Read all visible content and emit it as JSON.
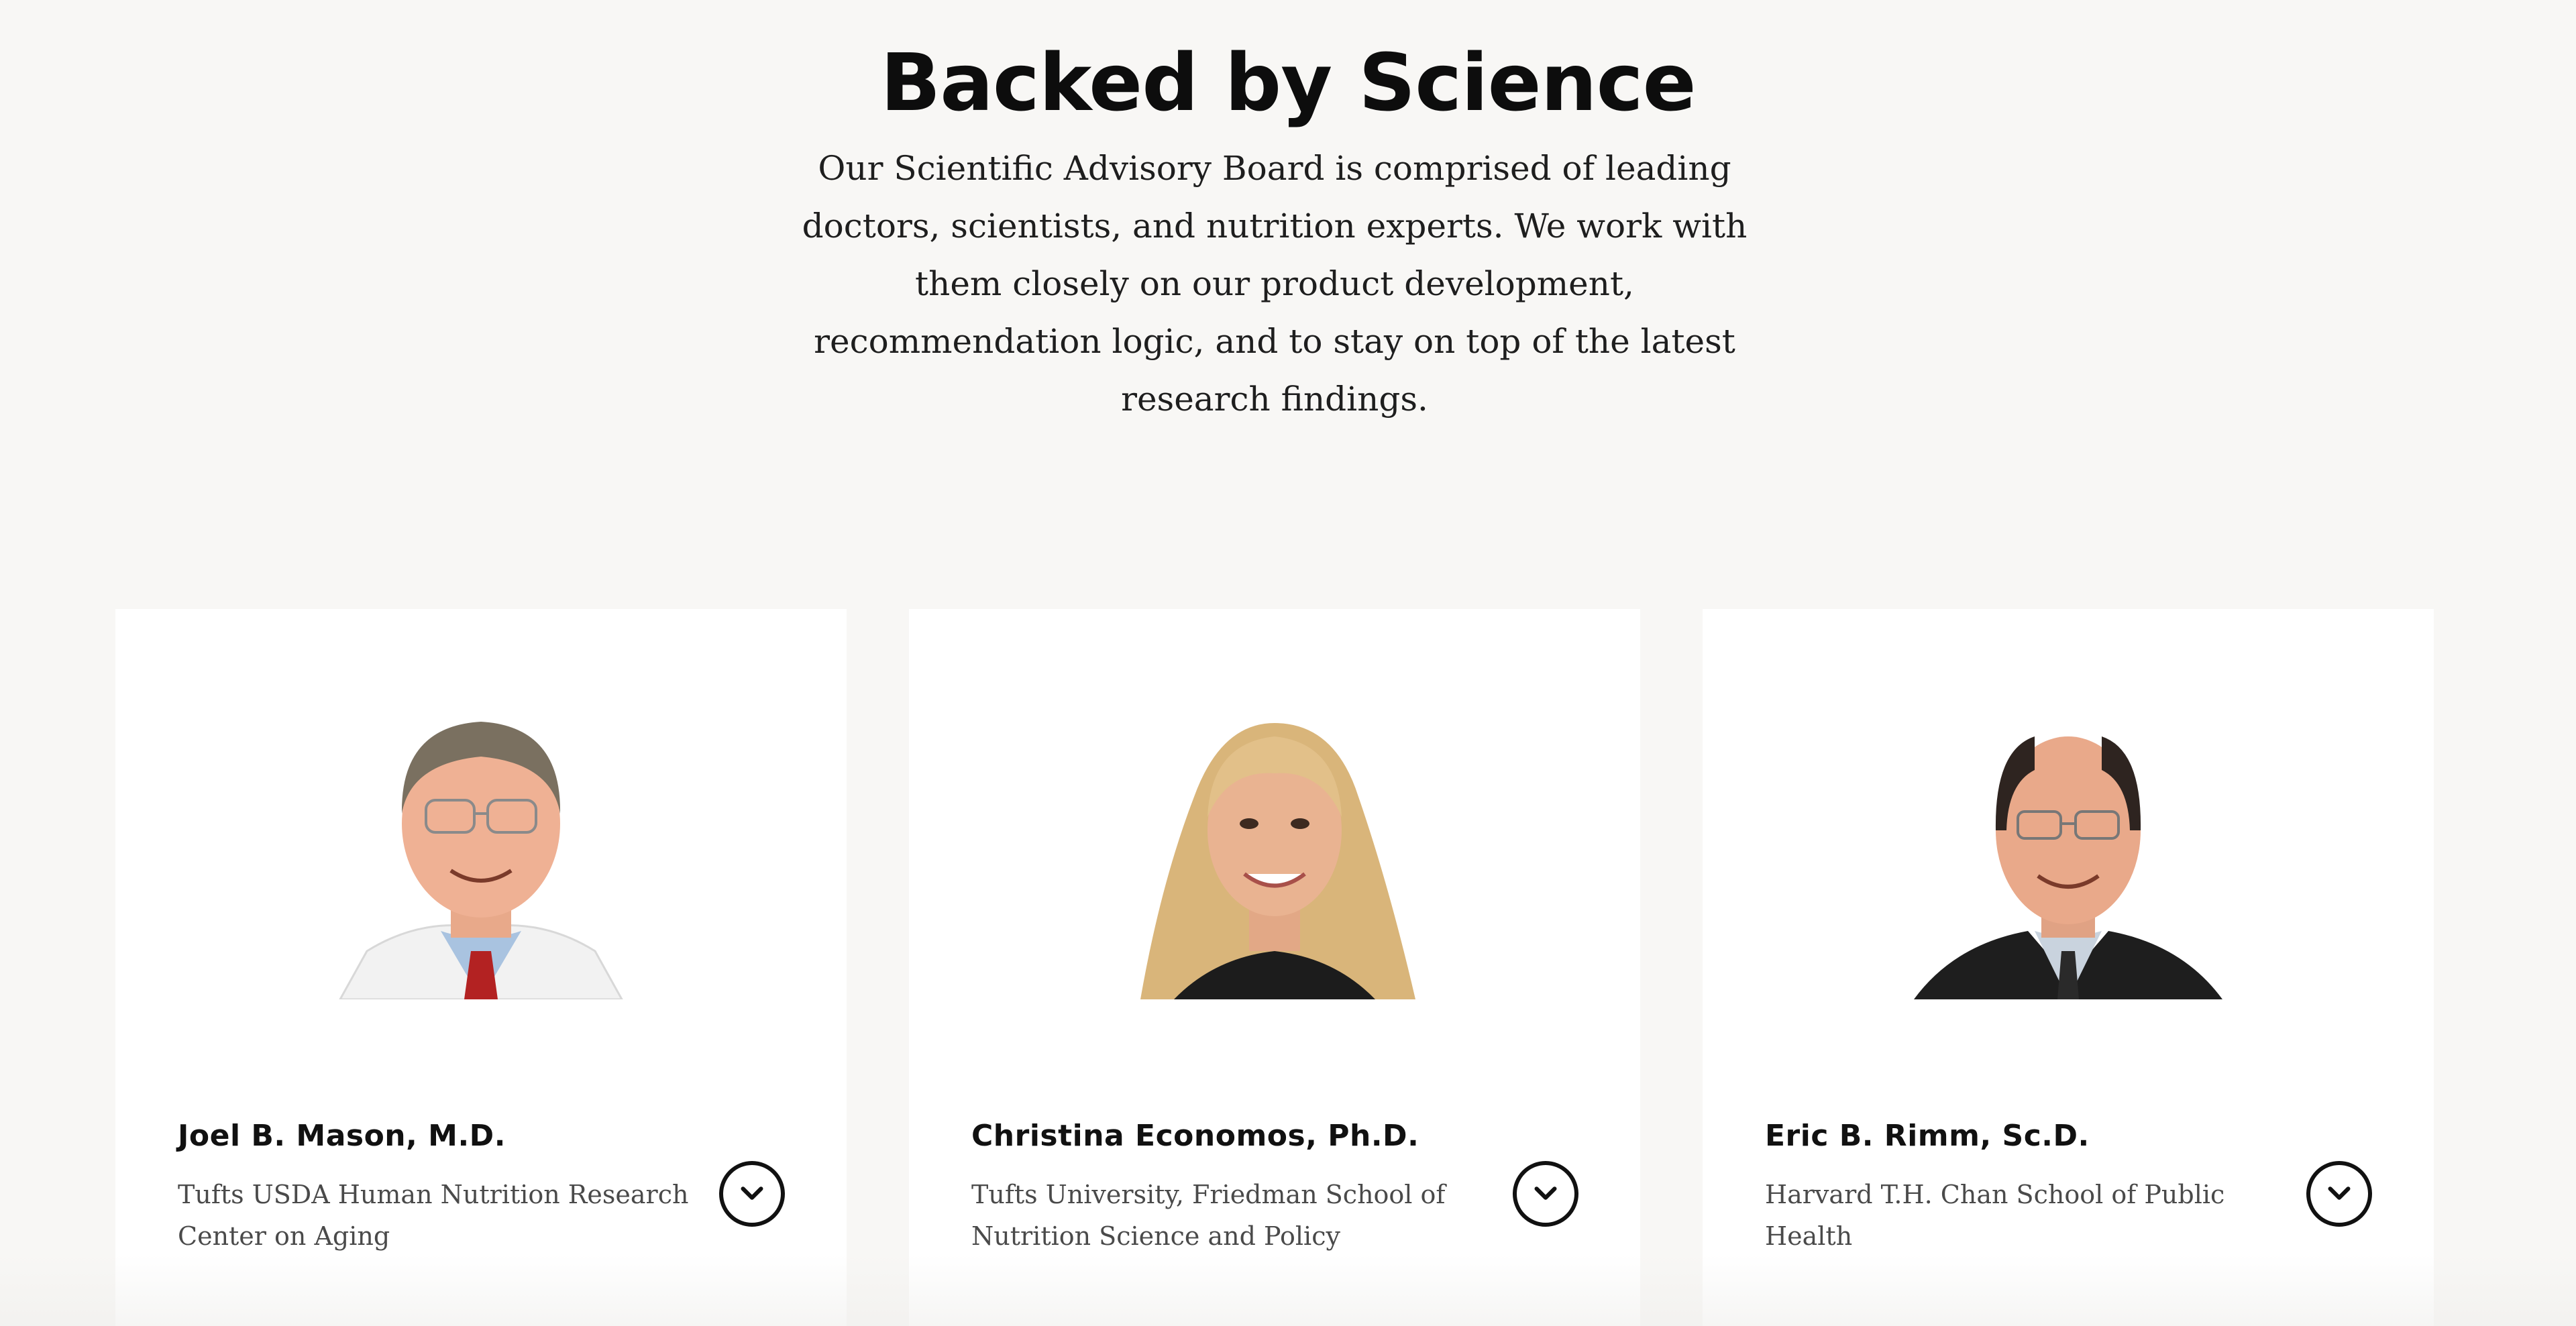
{
  "section": {
    "title": "Backed by Science",
    "intro": "Our Scientific Advisory Board is comprised of leading doctors, scientists, and nutrition experts. We work with them closely on our product development, recommendation logic, and to stay on top of the latest research findings."
  },
  "advisors": [
    {
      "name": "Joel B. Mason, M.D.",
      "affiliation": "Tufts USDA Human Nutrition Research Center on Aging",
      "icon": "chevron-down-icon"
    },
    {
      "name": "Christina Economos, Ph.D.",
      "affiliation": "Tufts University, Friedman School of Nutrition Science and Policy",
      "icon": "chevron-down-icon"
    },
    {
      "name": "Eric B. Rimm, Sc.D.",
      "affiliation": "Harvard T.H. Chan School of Public Health",
      "icon": "chevron-down-icon"
    }
  ],
  "colors": {
    "page_background": "#f8f7f5",
    "card_background": "#ffffff",
    "text_primary": "#111111",
    "text_secondary": "#4a4a4a"
  }
}
